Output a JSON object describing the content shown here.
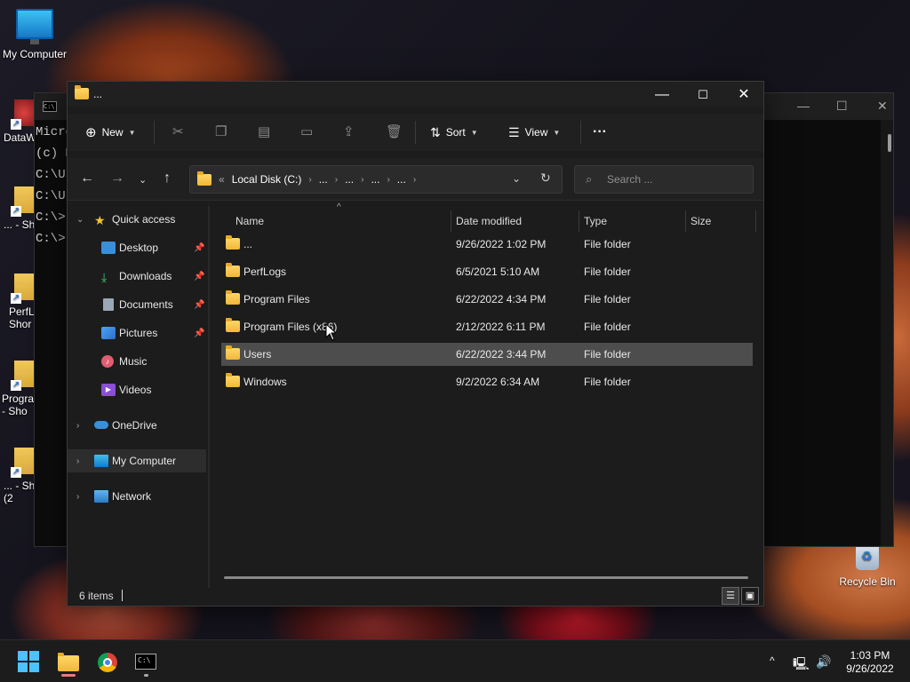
{
  "desktop": {
    "my_computer_label": "My Computer",
    "recycle_bin_label": "Recycle Bin",
    "side_labels": [
      "DataW",
      "... - Sh",
      "PerfL\nShor",
      "Progra\n- Sho",
      "... - Sh\n(2"
    ]
  },
  "terminal": {
    "lines": [
      "Micro",
      "(c) M",
      "",
      "C:\\Us",
      "",
      "C:\\Us",
      "",
      "C:\\>",
      "",
      "C:\\>"
    ]
  },
  "explorer": {
    "title": "...",
    "toolbar": {
      "new_label": "New",
      "sort_label": "Sort",
      "view_label": "View",
      "more_label": "···"
    },
    "address": {
      "root": "Local Disk (C:)",
      "prefix": "«",
      "crumbs": [
        "...",
        "...",
        "...",
        "..."
      ]
    },
    "search": {
      "placeholder": "Search ..."
    },
    "nav": {
      "quick_access": "Quick access",
      "desktop": "Desktop",
      "downloads": "Downloads",
      "documents": "Documents",
      "pictures": "Pictures",
      "music": "Music",
      "videos": "Videos",
      "onedrive": "OneDrive",
      "my_computer": "My Computer",
      "network": "Network"
    },
    "columns": {
      "name": "Name",
      "date": "Date modified",
      "type": "Type",
      "size": "Size"
    },
    "files": [
      {
        "name": "...",
        "date": "9/26/2022 1:02 PM",
        "type": "File folder"
      },
      {
        "name": "PerfLogs",
        "date": "6/5/2021 5:10 AM",
        "type": "File folder"
      },
      {
        "name": "Program Files",
        "date": "6/22/2022 4:34 PM",
        "type": "File folder"
      },
      {
        "name": "Program Files (x86)",
        "date": "2/12/2022 6:11 PM",
        "type": "File folder"
      },
      {
        "name": "Users",
        "date": "6/22/2022 3:44 PM",
        "type": "File folder"
      },
      {
        "name": "Windows",
        "date": "9/2/2022 6:34 AM",
        "type": "File folder"
      }
    ],
    "status": {
      "count": "6 items"
    }
  },
  "taskbar": {
    "time": "1:03 PM",
    "date": "9/26/2022"
  },
  "colors": {
    "accent": "#4cc2ff",
    "folder": "#f2b73a",
    "window_bg": "#1c1c1c",
    "row_hover": "#4d4d4d"
  }
}
